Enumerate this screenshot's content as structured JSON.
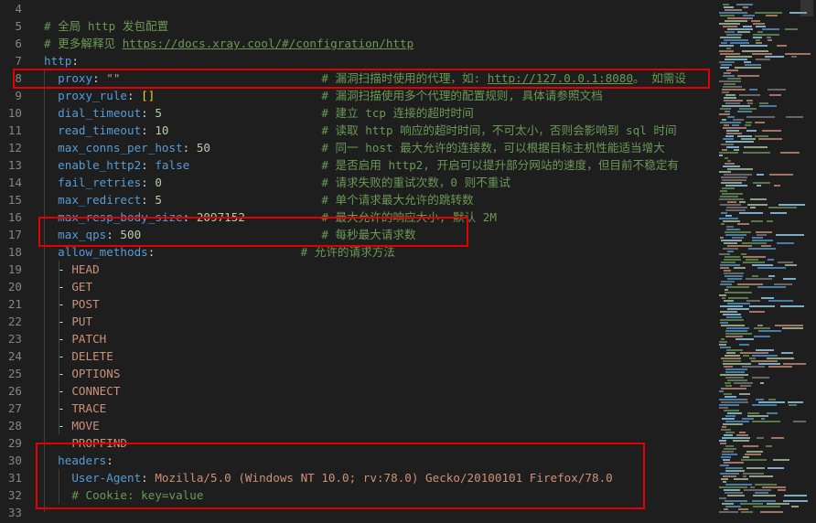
{
  "lines": [
    {
      "num": "4",
      "parts": []
    },
    {
      "num": "5",
      "parts": [
        {
          "c": "c",
          "t": "# 全局 http 发包配置"
        }
      ]
    },
    {
      "num": "6",
      "parts": [
        {
          "c": "c",
          "t": "# 更多解释见 "
        },
        {
          "c": "u",
          "t": "https://docs.xray.cool/#/configration/http"
        }
      ]
    },
    {
      "num": "7",
      "parts": [
        {
          "c": "k",
          "t": "http"
        },
        {
          "c": "p",
          "t": ":"
        }
      ]
    },
    {
      "num": "8",
      "parts": [
        {
          "c": "p",
          "t": "  "
        },
        {
          "c": "k",
          "t": "proxy"
        },
        {
          "c": "p",
          "t": ": "
        },
        {
          "c": "s",
          "t": "\"\""
        },
        {
          "c": "p",
          "t": "                             "
        },
        {
          "c": "c",
          "t": "# 漏洞扫描时使用的代理，如: "
        },
        {
          "c": "u",
          "t": "http://127.0.0.1:8080"
        },
        {
          "c": "c",
          "t": "。 如需设"
        }
      ]
    },
    {
      "num": "9",
      "parts": [
        {
          "c": "p",
          "t": "  "
        },
        {
          "c": "k",
          "t": "proxy_rule"
        },
        {
          "c": "p",
          "t": ": "
        },
        {
          "c": "b",
          "t": "[]"
        },
        {
          "c": "p",
          "t": "                        "
        },
        {
          "c": "c",
          "t": "# 漏洞扫描使用多个代理的配置规则, 具体请参照文档"
        }
      ]
    },
    {
      "num": "10",
      "parts": [
        {
          "c": "p",
          "t": "  "
        },
        {
          "c": "k",
          "t": "dial_timeout"
        },
        {
          "c": "p",
          "t": ": "
        },
        {
          "c": "n",
          "t": "5"
        },
        {
          "c": "p",
          "t": "                       "
        },
        {
          "c": "c",
          "t": "# 建立 tcp 连接的超时时间"
        }
      ]
    },
    {
      "num": "11",
      "parts": [
        {
          "c": "p",
          "t": "  "
        },
        {
          "c": "k",
          "t": "read_timeout"
        },
        {
          "c": "p",
          "t": ": "
        },
        {
          "c": "n",
          "t": "10"
        },
        {
          "c": "p",
          "t": "                      "
        },
        {
          "c": "c",
          "t": "# 读取 http 响应的超时时间，不可太小，否则会影响到 sql 时间"
        }
      ]
    },
    {
      "num": "12",
      "parts": [
        {
          "c": "p",
          "t": "  "
        },
        {
          "c": "k",
          "t": "max_conns_per_host"
        },
        {
          "c": "p",
          "t": ": "
        },
        {
          "c": "n",
          "t": "50"
        },
        {
          "c": "p",
          "t": "                "
        },
        {
          "c": "c",
          "t": "# 同一 host 最大允许的连接数，可以根据目标主机性能适当增大"
        }
      ]
    },
    {
      "num": "13",
      "parts": [
        {
          "c": "p",
          "t": "  "
        },
        {
          "c": "k",
          "t": "enable_http2"
        },
        {
          "c": "p",
          "t": ": "
        },
        {
          "c": "k",
          "t": "false"
        },
        {
          "c": "p",
          "t": "                   "
        },
        {
          "c": "c",
          "t": "# 是否启用 http2, 开启可以提升部分网站的速度，但目前不稳定有"
        }
      ]
    },
    {
      "num": "14",
      "parts": [
        {
          "c": "p",
          "t": "  "
        },
        {
          "c": "k",
          "t": "fail_retries"
        },
        {
          "c": "p",
          "t": ": "
        },
        {
          "c": "n",
          "t": "0"
        },
        {
          "c": "p",
          "t": "                       "
        },
        {
          "c": "c",
          "t": "# 请求失败的重试次数，0 则不重试"
        }
      ]
    },
    {
      "num": "15",
      "parts": [
        {
          "c": "p",
          "t": "  "
        },
        {
          "c": "k",
          "t": "max_redirect"
        },
        {
          "c": "p",
          "t": ": "
        },
        {
          "c": "n",
          "t": "5"
        },
        {
          "c": "p",
          "t": "                       "
        },
        {
          "c": "c",
          "t": "# 单个请求最大允许的跳转数"
        }
      ]
    },
    {
      "num": "16",
      "parts": [
        {
          "c": "p",
          "t": "  "
        },
        {
          "c": "k",
          "t": "max_resp_body_size"
        },
        {
          "c": "p",
          "t": ": "
        },
        {
          "c": "n",
          "t": "2097152"
        },
        {
          "c": "p",
          "t": "           "
        },
        {
          "c": "c",
          "t": "# 最大允许的响应大小, 默认 2M"
        }
      ]
    },
    {
      "num": "17",
      "parts": [
        {
          "c": "p",
          "t": "  "
        },
        {
          "c": "k",
          "t": "max_qps"
        },
        {
          "c": "p",
          "t": ": "
        },
        {
          "c": "n",
          "t": "500"
        },
        {
          "c": "p",
          "t": "                          "
        },
        {
          "c": "c",
          "t": "# 每秒最大请求数"
        }
      ]
    },
    {
      "num": "18",
      "parts": [
        {
          "c": "p",
          "t": "  "
        },
        {
          "c": "k",
          "t": "allow_methods"
        },
        {
          "c": "p",
          "t": ":                     "
        },
        {
          "c": "c",
          "t": "# 允许的请求方法"
        }
      ]
    },
    {
      "num": "19",
      "parts": [
        {
          "c": "p",
          "t": "  - "
        },
        {
          "c": "s",
          "t": "HEAD"
        }
      ]
    },
    {
      "num": "20",
      "parts": [
        {
          "c": "p",
          "t": "  - "
        },
        {
          "c": "s",
          "t": "GET"
        }
      ]
    },
    {
      "num": "21",
      "parts": [
        {
          "c": "p",
          "t": "  - "
        },
        {
          "c": "s",
          "t": "POST"
        }
      ]
    },
    {
      "num": "22",
      "parts": [
        {
          "c": "p",
          "t": "  - "
        },
        {
          "c": "s",
          "t": "PUT"
        }
      ]
    },
    {
      "num": "23",
      "parts": [
        {
          "c": "p",
          "t": "  - "
        },
        {
          "c": "s",
          "t": "PATCH"
        }
      ]
    },
    {
      "num": "24",
      "parts": [
        {
          "c": "p",
          "t": "  - "
        },
        {
          "c": "s",
          "t": "DELETE"
        }
      ]
    },
    {
      "num": "25",
      "parts": [
        {
          "c": "p",
          "t": "  - "
        },
        {
          "c": "s",
          "t": "OPTIONS"
        }
      ]
    },
    {
      "num": "26",
      "parts": [
        {
          "c": "p",
          "t": "  - "
        },
        {
          "c": "s",
          "t": "CONNECT"
        }
      ]
    },
    {
      "num": "27",
      "parts": [
        {
          "c": "p",
          "t": "  - "
        },
        {
          "c": "s",
          "t": "TRACE"
        }
      ]
    },
    {
      "num": "28",
      "parts": [
        {
          "c": "p",
          "t": "  - "
        },
        {
          "c": "s",
          "t": "MOVE"
        }
      ]
    },
    {
      "num": "29",
      "parts": [
        {
          "c": "p",
          "t": "  - "
        },
        {
          "c": "s",
          "t": "PROPFIND"
        }
      ]
    },
    {
      "num": "30",
      "parts": [
        {
          "c": "p",
          "t": "  "
        },
        {
          "c": "k",
          "t": "headers"
        },
        {
          "c": "p",
          "t": ":"
        }
      ]
    },
    {
      "num": "31",
      "parts": [
        {
          "c": "p",
          "t": "    "
        },
        {
          "c": "k",
          "t": "User-Agent"
        },
        {
          "c": "p",
          "t": ": "
        },
        {
          "c": "s",
          "t": "Mozilla/5.0 (Windows NT 10.0; rv:78.0) Gecko/20100101 Firefox/78.0"
        }
      ]
    },
    {
      "num": "32",
      "parts": [
        {
          "c": "p",
          "t": "    "
        },
        {
          "c": "c",
          "t": "# Cookie: key=value"
        }
      ]
    },
    {
      "num": "33",
      "parts": []
    }
  ],
  "colors": {
    "background": "#1e1e1e",
    "highlight_box": "#e50000",
    "keyword": "#569cd6",
    "string": "#ce9178",
    "number": "#b5cea8",
    "comment": "#6a9955"
  }
}
